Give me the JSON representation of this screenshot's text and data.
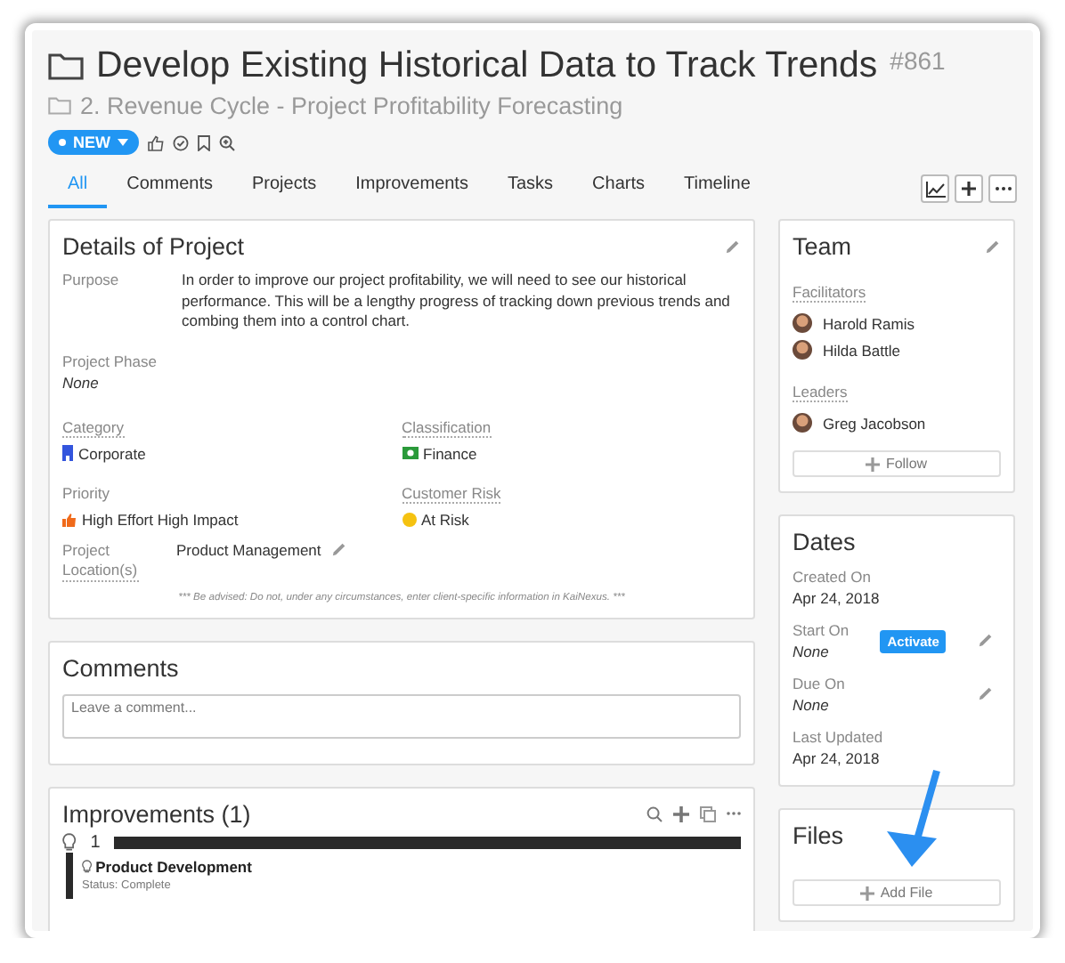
{
  "header": {
    "title": "Develop Existing Historical Data to Track Trends",
    "number": "#861",
    "breadcrumb": "2. Revenue Cycle - Project Profitability Forecasting",
    "status": "NEW"
  },
  "tabs": [
    {
      "label": "All",
      "selected": true
    },
    {
      "label": "Comments",
      "selected": false
    },
    {
      "label": "Projects",
      "selected": false
    },
    {
      "label": "Improvements",
      "selected": false
    },
    {
      "label": "Tasks",
      "selected": false
    },
    {
      "label": "Charts",
      "selected": false
    },
    {
      "label": "Timeline",
      "selected": false
    }
  ],
  "details": {
    "title": "Details of Project",
    "purpose": {
      "label": "Purpose",
      "value": "In order to improve our project profitability, we will need to see our historical performance. This will be a lengthy progress of tracking down previous trends and combing them into a control chart."
    },
    "phase": {
      "label": "Project Phase",
      "value": "None",
      "empty": true
    },
    "fields": [
      {
        "label": "Category",
        "value": "Corporate",
        "underlined": true,
        "kind": "building"
      },
      {
        "label": "Classification",
        "value": "Finance",
        "underlined": true,
        "kind": "money"
      },
      {
        "label": "Priority",
        "value": "High Effort High Impact",
        "underlined": false,
        "kind": "thumb"
      },
      {
        "label": "Customer Risk",
        "value": "At Risk",
        "underlined": true,
        "kind": "dot"
      }
    ],
    "location": {
      "label": "Project Location(s)",
      "value": "Product Management"
    },
    "disclaimer": "*** Be advised: Do not, under any circumstances, enter client-specific information in KaiNexus. ***"
  },
  "comments": {
    "title": "Comments",
    "placeholder": "Leave a comment..."
  },
  "improvements": {
    "title": "Improvements (1)",
    "group_count": "1",
    "items": [
      {
        "name": "Product Development",
        "status": "Status: Complete"
      }
    ]
  },
  "team": {
    "title": "Team",
    "groups": [
      {
        "label": "Facilitators",
        "members": [
          {
            "name": "Harold Ramis"
          },
          {
            "name": "Hilda Battle"
          }
        ]
      },
      {
        "label": "Leaders",
        "members": [
          {
            "name": "Greg Jacobson"
          }
        ]
      }
    ],
    "follow": "Follow"
  },
  "dates": {
    "title": "Dates",
    "rows": [
      {
        "label": "Created On",
        "value": "Apr 24, 2018",
        "empty": false,
        "editable": false
      },
      {
        "label": "Start On",
        "value": "None",
        "empty": true,
        "editable": true,
        "action": "Activate"
      },
      {
        "label": "Due On",
        "value": "None",
        "empty": true,
        "editable": true
      },
      {
        "label": "Last Updated",
        "value": "Apr 24, 2018",
        "empty": false,
        "editable": false
      }
    ]
  },
  "files": {
    "title": "Files",
    "add": "Add File"
  }
}
